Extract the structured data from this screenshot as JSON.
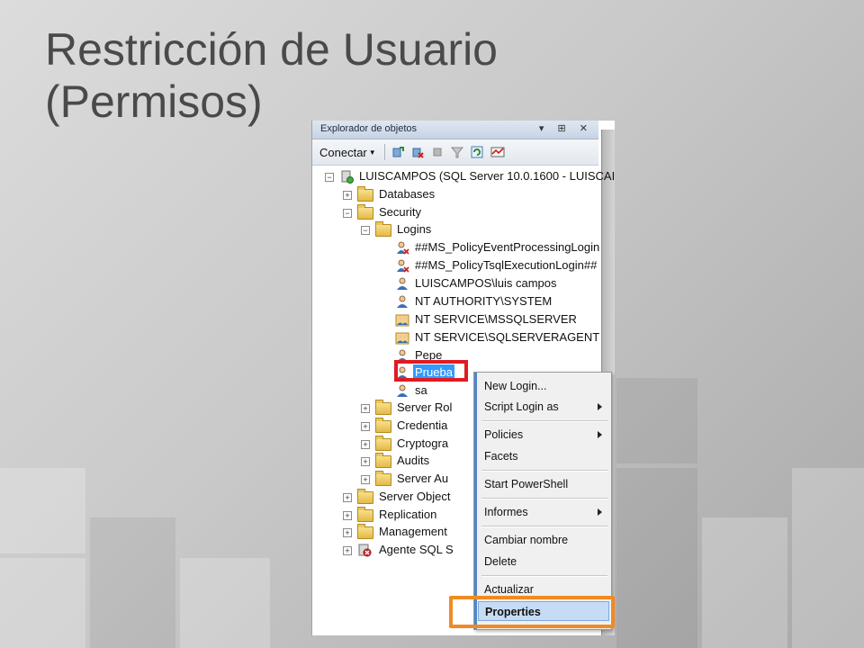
{
  "slide": {
    "title_line1": "Restricción de Usuario",
    "title_line2": "(Permisos)"
  },
  "panel": {
    "header_title": "Explorador de objetos",
    "header_buttons": "▾ ⊞ ✕",
    "toolbar": {
      "connect_label": "Conectar",
      "icons": [
        "connect-icon",
        "disconnect-icon",
        "stop-icon",
        "filter-icon",
        "refresh-icon",
        "activity-monitor-icon"
      ]
    }
  },
  "tree": {
    "server": "LUISCAMPOS (SQL Server 10.0.1600 - LUISCAI",
    "databases": "Databases",
    "security": "Security",
    "logins": "Logins",
    "login_items": [
      "##MS_PolicyEventProcessingLogin",
      "##MS_PolicyTsqlExecutionLogin##",
      "LUISCAMPOS\\luis campos",
      "NT AUTHORITY\\SYSTEM",
      "NT SERVICE\\MSSQLSERVER",
      "NT SERVICE\\SQLSERVERAGENT",
      "Pepe",
      "Prueba",
      "sa"
    ],
    "security_children": [
      "Server Rol",
      "Credentia",
      "Cryptogra",
      "Audits",
      "Server Au"
    ],
    "root_children": [
      "Server Object",
      "Replication",
      "Management",
      "Agente SQL S"
    ]
  },
  "context_menu": {
    "items": [
      {
        "label": "New Login..."
      },
      {
        "label": "Script Login as"
      },
      {
        "label": "Policies"
      },
      {
        "label": "Facets"
      },
      {
        "label": "Start PowerShell"
      },
      {
        "label": "Informes"
      },
      {
        "label": "Cambiar nombre"
      },
      {
        "label": "Delete"
      },
      {
        "label": "Actualizar"
      },
      {
        "label": "Properties"
      }
    ]
  },
  "colors": {
    "selection": "#3399ff",
    "red_highlight": "#e01b22",
    "orange_highlight": "#f08a24",
    "menu_active": "#c6dcf4"
  }
}
